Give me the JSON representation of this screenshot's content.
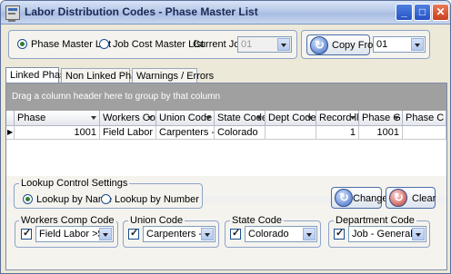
{
  "window": {
    "title": "Labor Distribution Codes - Phase Master List"
  },
  "mode": {
    "option1": "Phase Master List",
    "option2": "Job Cost Master List",
    "selected": "Phase Master List",
    "current_job_label": "Current Job:",
    "current_job_value": "01",
    "copy_from_label": "Copy From",
    "copy_from_value": "01"
  },
  "tabs": [
    {
      "label": "Linked Phases",
      "active": true
    },
    {
      "label": "Non Linked Phases",
      "active": false
    },
    {
      "label": "Warnings / Errors",
      "active": false
    }
  ],
  "grid": {
    "group_hint": "Drag a column header here to group by that column",
    "columns": [
      "Phase",
      "Workers Com",
      "Union Code",
      "State Code",
      "Dept Code",
      "Record ll",
      "Phase G",
      "Phase C"
    ],
    "rows": [
      [
        "1001",
        "Field Labor >$XX",
        "Carpenters - Jou",
        "Colorado",
        "",
        "1",
        "1001",
        ""
      ]
    ]
  },
  "lookup": {
    "title": "Lookup Control Settings",
    "by_name": "Lookup by Name",
    "by_number": "Lookup by Number",
    "selected": "Lookup by Name"
  },
  "buttons": {
    "change": "Change",
    "clear": "Clear"
  },
  "filters": {
    "workers_comp": {
      "label": "Workers Comp Code",
      "checked": true,
      "value": "Field Labor >$XX/h"
    },
    "union": {
      "label": "Union Code",
      "checked": true,
      "value": "Carpenters - Journ"
    },
    "state": {
      "label": "State Code",
      "checked": true,
      "value": "Colorado"
    },
    "department": {
      "label": "Department Code",
      "checked": true,
      "value": "Job - General Labor"
    }
  }
}
